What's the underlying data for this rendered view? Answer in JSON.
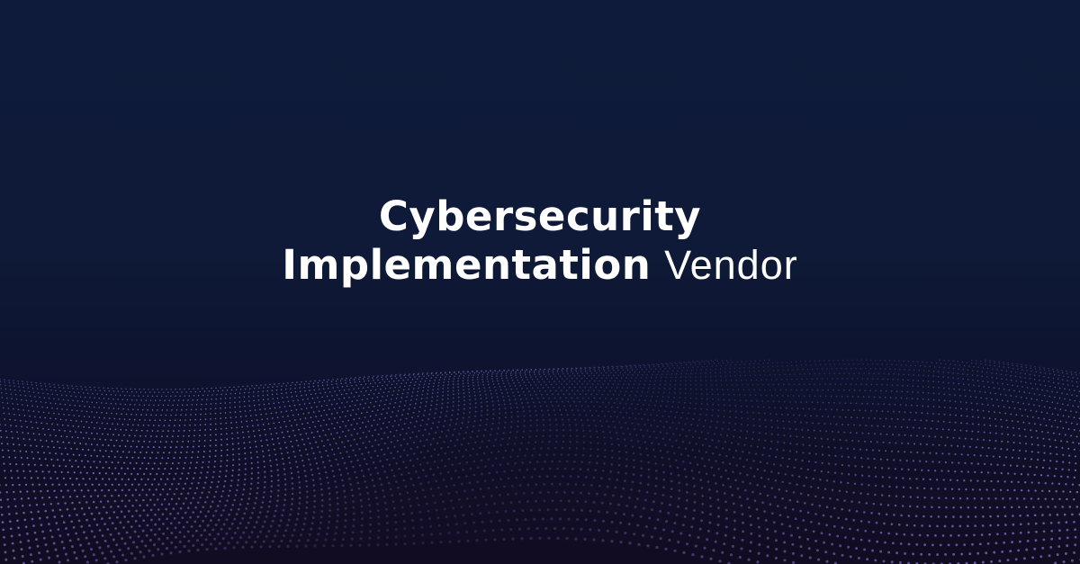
{
  "headline": {
    "line1": "Cybersecurity",
    "line2_bold": "Implementation",
    "line2_light": "Vendor"
  },
  "colors": {
    "background_top": "#0e1b3a",
    "background_bottom": "#120c22",
    "text": "#ffffff",
    "dots": "#8a7fd8"
  },
  "decoration": {
    "wave": "particle-dot-wave"
  }
}
